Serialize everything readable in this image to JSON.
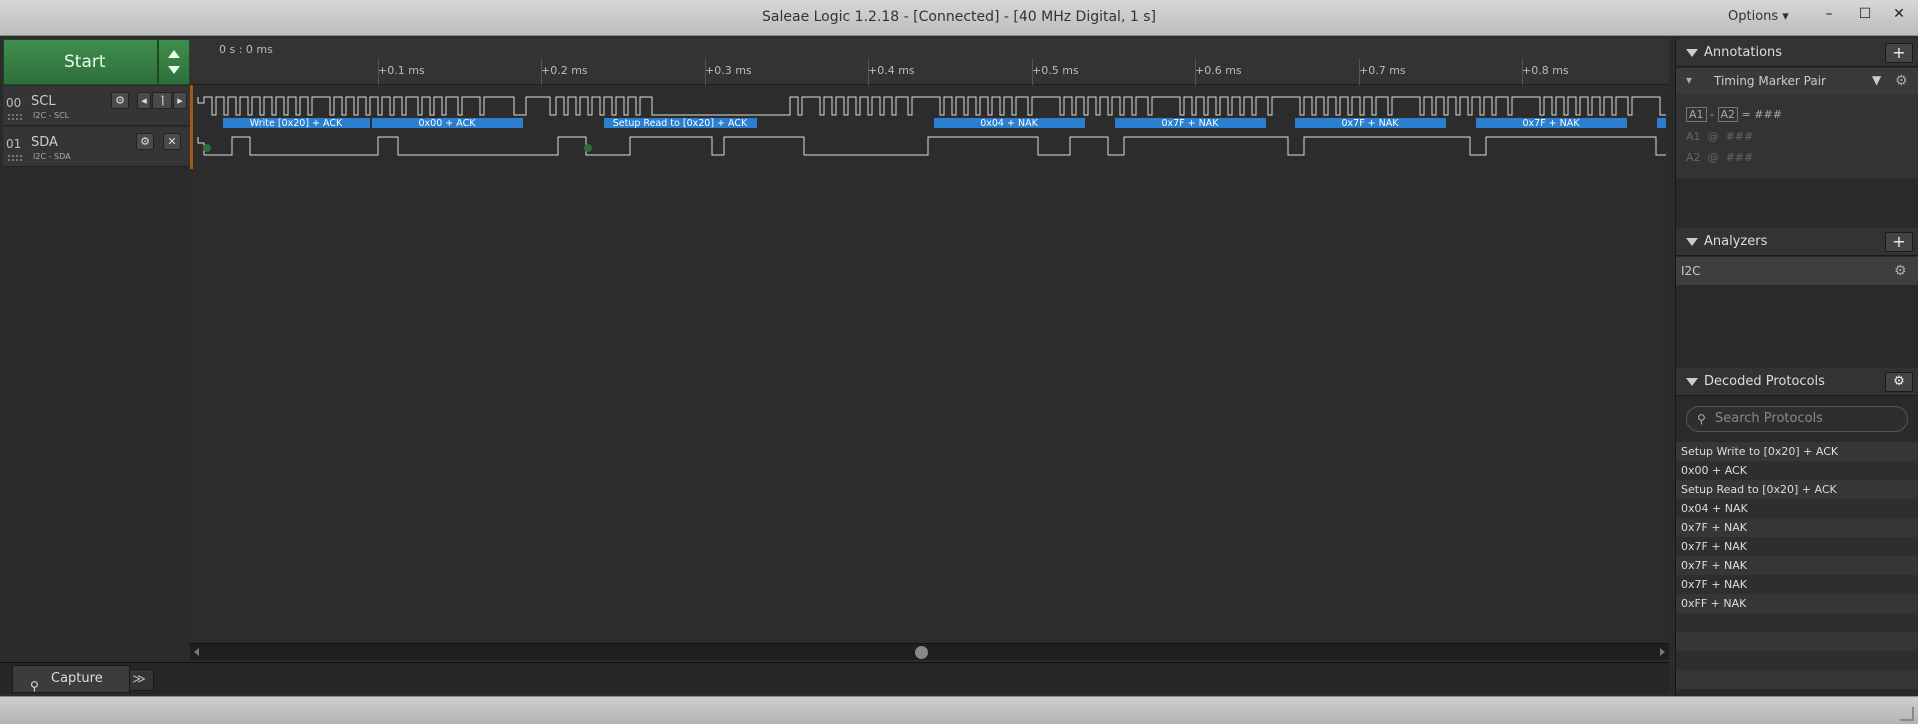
{
  "window": {
    "title": "Saleae Logic 1.2.18 - [Connected] - [40 MHz Digital, 1 s]",
    "options_label": "Options ▾",
    "minimize": "–",
    "maximize": "☐",
    "close": "✕"
  },
  "controls": {
    "start_label": "Start"
  },
  "channels": [
    {
      "num": "00",
      "name": "SCL",
      "sub": "I2C - SCL"
    },
    {
      "num": "01",
      "name": "SDA",
      "sub": "I2C - SDA"
    }
  ],
  "ruler": {
    "origin": "0 s : 0 ms",
    "ticks": [
      "+0.1 ms",
      "+0.2 ms",
      "+0.3 ms",
      "+0.4 ms",
      "+0.5 ms",
      "+0.6 ms",
      "+0.7 ms",
      "+0.8 ms"
    ]
  },
  "decode_bubbles": [
    "Write [0x20] + ACK",
    "0x00 + ACK",
    "Setup Read to [0x20] + ACK",
    "0x04 + NAK",
    "0x7F + NAK",
    "0x7F + NAK",
    "0x7F + NAK"
  ],
  "bottom": {
    "capture_tab": "Capture",
    "more": "≫"
  },
  "annotations": {
    "title": "Annotations",
    "add": "+",
    "marker_type": "Timing Marker Pair",
    "line1_a1": "A1",
    "line1_sep": "-",
    "line1_a2": "A2",
    "line1_val": "= ###",
    "line2": "A1  @  ###",
    "line3": "A2  @  ###"
  },
  "analyzers": {
    "title": "Analyzers",
    "add": "+",
    "items": [
      "I2C"
    ]
  },
  "decoded": {
    "title": "Decoded Protocols",
    "search_placeholder": "Search Protocols",
    "rows": [
      "Setup Write to [0x20] + ACK",
      "0x00 + ACK",
      "Setup Read to [0x20] + ACK",
      "0x04 + NAK",
      "0x7F + NAK",
      "0x7F + NAK",
      "0x7F + NAK",
      "0x7F + NAK",
      "0xFF + NAK"
    ]
  },
  "colors": {
    "start_green": "#3f8d4c",
    "decode_blue": "#2a7fd0",
    "marker_orange": "#a05a18"
  }
}
